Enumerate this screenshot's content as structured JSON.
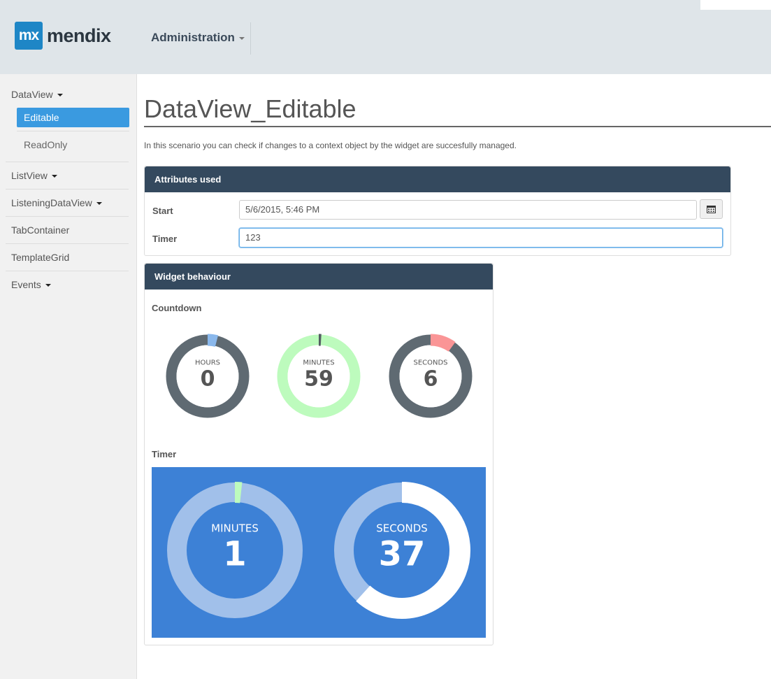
{
  "header": {
    "logo_mark": "mx",
    "logo_text": "mendix",
    "nav_admin": "Administration"
  },
  "sidebar": {
    "dataview": "DataView",
    "editable": "Editable",
    "readonly": "ReadOnly",
    "listview": "ListView",
    "listening": "ListeningDataView",
    "tabcontainer": "TabContainer",
    "templategrid": "TemplateGrid",
    "events": "Events"
  },
  "main": {
    "title": "DataView_Editable",
    "intro": "In this scenario you can check if changes to a context object by the widget are succesfully managed."
  },
  "attributes": {
    "heading": "Attributes used",
    "start_label": "Start",
    "start_value": "5/6/2015, 5:46 PM",
    "timer_label": "Timer",
    "timer_value": "123"
  },
  "widget": {
    "heading": "Widget behaviour",
    "countdown_label": "Countdown",
    "timer_label": "Timer",
    "countdown": [
      {
        "label": "HOURS",
        "value": "0",
        "fraction": 0.04,
        "color": "#8ab8ec",
        "track": "#5f6a72",
        "bg": "#ffffff",
        "text": "#555555"
      },
      {
        "label": "MINUTES",
        "value": "59",
        "fraction": 0.01,
        "color": "#555e64",
        "track": "#bdfbbd",
        "bg": "#ffffff",
        "text": "#555555"
      },
      {
        "label": "SECONDS",
        "value": "6",
        "fraction": 0.1,
        "color": "#fa9596",
        "track": "#5f6a72",
        "bg": "#ffffff",
        "text": "#555555"
      }
    ],
    "timer": [
      {
        "label": "MINUTES",
        "value": "1",
        "fraction": 0.017,
        "color": "#bdfbbd",
        "track": "#a1c0ea",
        "text": "#ffffff"
      },
      {
        "label": "SECONDS",
        "value": "37",
        "fraction": 0.617,
        "color": "#ffffff",
        "track": "#a1c0ea",
        "text": "#ffffff"
      }
    ],
    "timer_bg": "#3d81d6"
  }
}
